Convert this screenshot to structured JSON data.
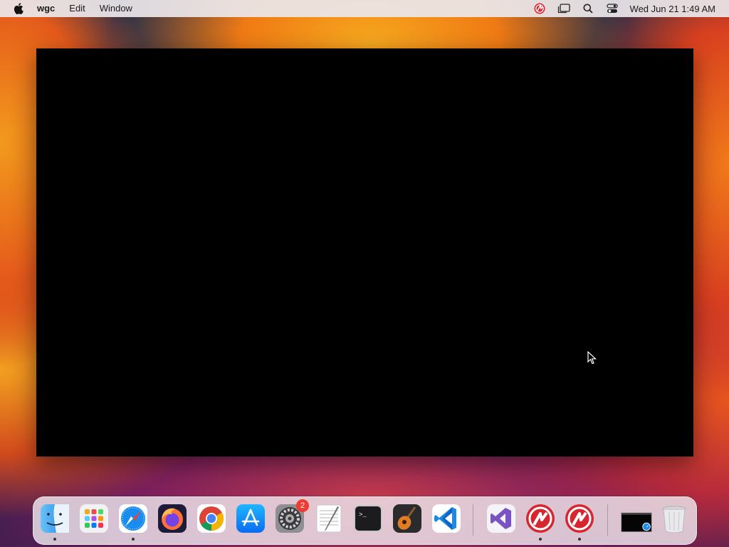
{
  "menubar": {
    "app_name": "wgc",
    "menus": [
      "Edit",
      "Window"
    ],
    "clock": "Wed Jun 21  1:49 AM",
    "icons": [
      "apple-icon",
      "wargaming-status-icon",
      "stage-manager-icon",
      "spotlight-search-icon",
      "control-center-icon"
    ]
  },
  "window": {
    "state": "blank-black"
  },
  "dock": {
    "apps": [
      {
        "name": "Finder",
        "running": true
      },
      {
        "name": "Launchpad",
        "running": false
      },
      {
        "name": "Safari",
        "running": true
      },
      {
        "name": "Firefox",
        "running": false
      },
      {
        "name": "Google Chrome",
        "running": false
      },
      {
        "name": "App Store",
        "running": false
      },
      {
        "name": "System Settings",
        "running": false,
        "badge": "2"
      },
      {
        "name": "TextEdit",
        "running": false
      },
      {
        "name": "Terminal",
        "running": false
      },
      {
        "name": "GarageBand",
        "running": false
      },
      {
        "name": "Visual Studio Code",
        "running": false
      },
      {
        "name": "Visual Studio",
        "running": false
      },
      {
        "name": "Wargaming Game Center",
        "running": true
      },
      {
        "name": "Wargaming Game Center",
        "running": true
      },
      {
        "name": "Window Preview",
        "running": false
      },
      {
        "name": "Trash",
        "running": false
      }
    ],
    "terminal_prompt": ">_"
  },
  "colors": {
    "menubar_bg": "#ebe8eb",
    "window_bg": "#000000",
    "badge": "#ef3b32"
  }
}
